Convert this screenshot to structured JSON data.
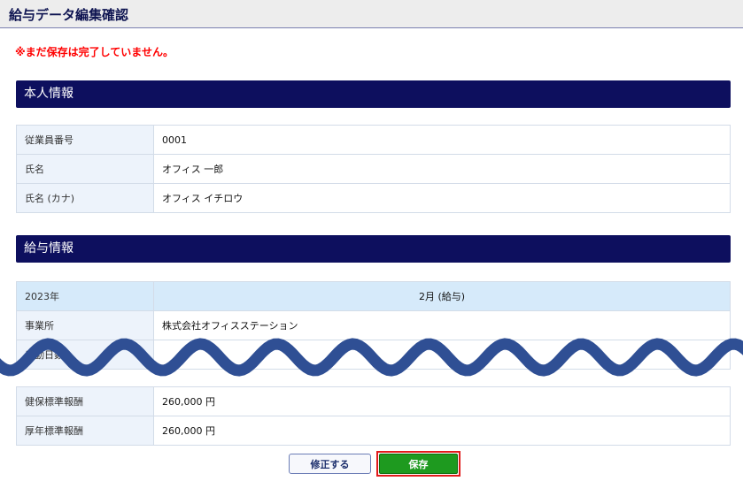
{
  "header": {
    "title": "給与データ編集確認"
  },
  "warning": "※まだ保存は完了していません。",
  "personal_section": {
    "title": "本人情報",
    "rows": [
      {
        "label": "従業員番号",
        "value": "0001"
      },
      {
        "label": "氏名",
        "value": "オフィス 一郎"
      },
      {
        "label": "氏名 (カナ)",
        "value": "オフィス イチロウ"
      }
    ]
  },
  "salary_section": {
    "title": "給与情報",
    "year": "2023年",
    "month": "2月 (給与)",
    "office_label": "事業所",
    "office_value": "株式会社オフィスステーション",
    "partial_label": "出勤日数",
    "rows": [
      {
        "label": "健保標準報酬",
        "value": "260,000 円"
      },
      {
        "label": "厚年標準報酬",
        "value": "260,000 円"
      }
    ]
  },
  "buttons": {
    "edit": "修正する",
    "save": "保存"
  },
  "colors": {
    "header_bar": "#0d0f5e",
    "warning_text": "#ff0000",
    "save_button": "#1e9a1f",
    "highlight_border": "#e21b1b",
    "wave": "#2f4f94"
  }
}
